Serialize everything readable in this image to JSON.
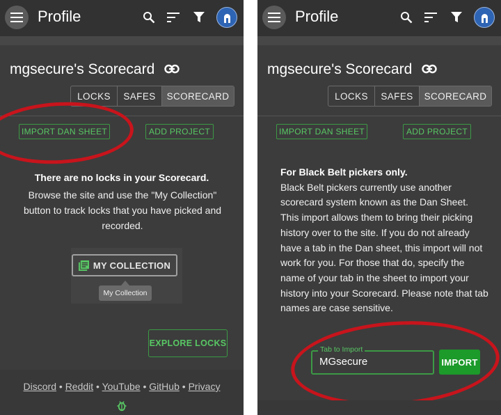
{
  "app_title": "Profile",
  "page_title": "mgsecure's Scorecard",
  "tabs": [
    "LOCKS",
    "SAFES",
    "SCORECARD"
  ],
  "active_tab": "SCORECARD",
  "actions": {
    "import_dan_sheet": "IMPORT DAN SHEET",
    "add_project": "ADD PROJECT"
  },
  "empty_state": {
    "title": "There are no locks in your Scorecard.",
    "body": "Browse the site and use the \"My Collection\" button to track locks that you have picked and recorded.",
    "my_collection_button": "MY COLLECTION",
    "tooltip": "My Collection",
    "explore_button": "EXPLORE LOCKS"
  },
  "footer": {
    "links": [
      "Discord",
      "Reddit",
      "YouTube",
      "GitHub",
      "Privacy"
    ],
    "separator": "•"
  },
  "import_panel": {
    "heading": "For Black Belt pickers only.",
    "body": "Black Belt pickers currently use another scorecard system known as the Dan Sheet. This import allows them to bring their picking history over to the site. If you do not already have a tab in the Dan sheet, this import will not work for you. For those that do, specify the name of your tab in the sheet to import your history into your Scorecard. Please note that tab names are case sensitive.",
    "input_label": "Tab to Import",
    "input_value": "MGsecure",
    "import_button": "IMPORT"
  },
  "icons": {
    "menu": "menu-icon",
    "search": "search-icon",
    "sort": "sort-icon",
    "filter": "filter-icon",
    "link": "link-icon",
    "collection": "collection-icon",
    "bug": "bug-icon",
    "avatar": "lock-avatar-icon"
  },
  "colors": {
    "accent_green": "#58c864",
    "import_green": "#1c9a2a",
    "highlight_red": "#c8141c",
    "avatar_blue": "#2e64b4"
  }
}
